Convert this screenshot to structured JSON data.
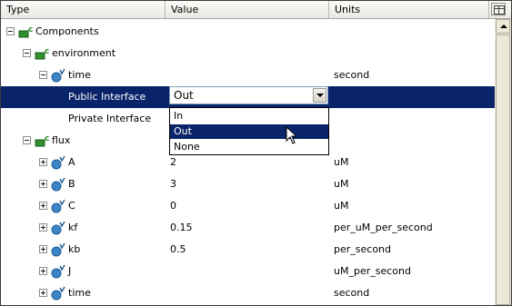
{
  "columns": {
    "type": "Type",
    "value": "Value",
    "units": "Units"
  },
  "tree": {
    "components": "Components",
    "environment": "environment",
    "env_time": {
      "name": "time",
      "units": "second"
    },
    "public_interface": {
      "label": "Public Interface",
      "value": "Out"
    },
    "private_interface": {
      "label": "Private Interface"
    },
    "flux": "flux",
    "vars": [
      {
        "name": "A",
        "value": "2",
        "units": "uM"
      },
      {
        "name": "B",
        "value": "3",
        "units": "uM"
      },
      {
        "name": "C",
        "value": "0",
        "units": "uM"
      },
      {
        "name": "kf",
        "value": "0.15",
        "units": "per_uM_per_second"
      },
      {
        "name": "kb",
        "value": "0.5",
        "units": "per_second"
      },
      {
        "name": "J",
        "value": "",
        "units": "uM_per_second"
      },
      {
        "name": "time",
        "value": "",
        "units": "second"
      }
    ]
  },
  "dropdown_options": [
    "In",
    "Out",
    "None"
  ],
  "highlighted_option": "Out",
  "icons": {
    "component": "component-icon",
    "variable": "variable-icon",
    "expander": "tree-expander-icon",
    "column_chooser": "column-chooser-icon",
    "cursor": "mouse-pointer-icon"
  },
  "colors": {
    "selection": "#0a246a",
    "component_green": "#2f8f2f",
    "variable_blue": "#3c86c8"
  }
}
